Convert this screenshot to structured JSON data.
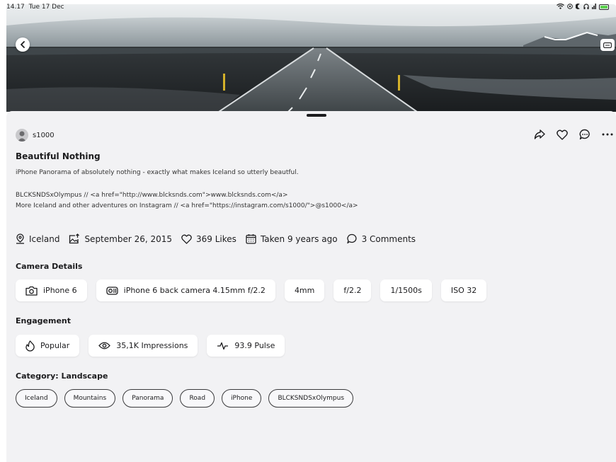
{
  "status_bar": {
    "time": "14.17",
    "date": "Tue 17 Dec"
  },
  "post": {
    "username": "s1000",
    "title": "Beautiful Nothing",
    "description_line1": "iPhone Panorama of absolutely nothing - exactly what makes Iceland so utterly beautful.",
    "description_line2": "BLCKSNDSxOlympus // <a href=\"http://www.blcksnds.com\">www.blcksnds.com</a>",
    "description_line3": "More Iceland and other adventures on Instagram // <a href=\"https://instagram.com/s1000/\">@s1000</a>"
  },
  "meta": {
    "location": "Iceland",
    "uploaded": "September 26, 2015",
    "likes": "369 Likes",
    "taken": "Taken 9 years ago",
    "comments": "3 Comments"
  },
  "camera": {
    "title": "Camera Details",
    "device": "iPhone 6",
    "lens": "iPhone 6 back camera 4.15mm f/2.2",
    "focal": "4mm",
    "aperture": "f/2.2",
    "shutter": "1/1500s",
    "iso": "ISO 32"
  },
  "engagement": {
    "title": "Engagement",
    "popular": "Popular",
    "impressions": "35,1K Impressions",
    "pulse": "93.9 Pulse"
  },
  "category": {
    "title": "Category: Landscape",
    "tags": [
      "Iceland",
      "Mountains",
      "Panorama",
      "Road",
      "iPhone",
      "BLCKSNDSxOlympus"
    ]
  },
  "colors": {
    "sheet_bg": "#f2f2f4",
    "chip_bg": "#ffffff",
    "text": "#1c1c1e",
    "battery": "#5ad14c"
  }
}
